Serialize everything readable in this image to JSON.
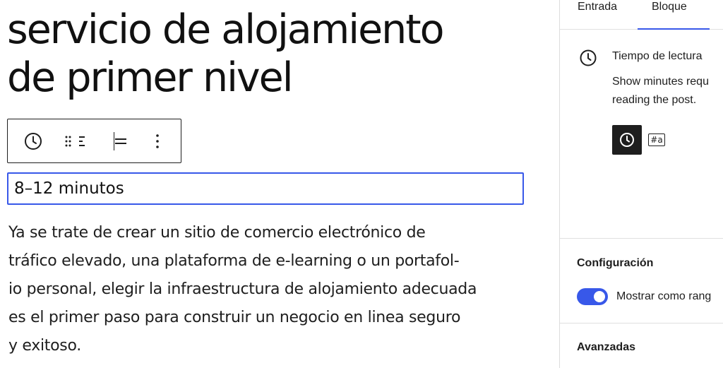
{
  "editor": {
    "title_line1": "servicio de alojamiento",
    "title_line2": "de primer nivel",
    "toolbar": {
      "clock_icon": "clock-icon",
      "drag_icon": "drag-handle-icon",
      "align_icon": "justify-icon",
      "more_icon": "more-vertical-icon"
    },
    "reading_time_value": "8–12 minutos",
    "paragraph_lines": [
      "Ya se trate de crear un sitio de comercio electrónico de",
      "tráfico elevado, una plataforma de e-learning o un portafol-",
      "io personal, elegir la infraestructura de alojamiento adecuada",
      "es el primer paso para construir un negocio en linea seguro",
      "y exitoso."
    ]
  },
  "sidebar": {
    "tabs": [
      "Entrada",
      "Bloque"
    ],
    "active_tab": "Bloque",
    "block": {
      "icon": "clock-icon",
      "title": "Tiempo de lectura",
      "description_line1": "Show minutes requ",
      "description_line2": "reading the post.",
      "styles": [
        "clock-icon",
        "#a"
      ],
      "selected_style": "clock-icon"
    },
    "config": {
      "heading": "Configuración",
      "toggle_label": "Mostrar como rang",
      "toggle_on": true
    },
    "advanced": {
      "heading": "Avanzadas"
    }
  },
  "colors": {
    "accent": "#3858e9",
    "text": "#1e1e1e",
    "border": "#e0e0e0"
  }
}
